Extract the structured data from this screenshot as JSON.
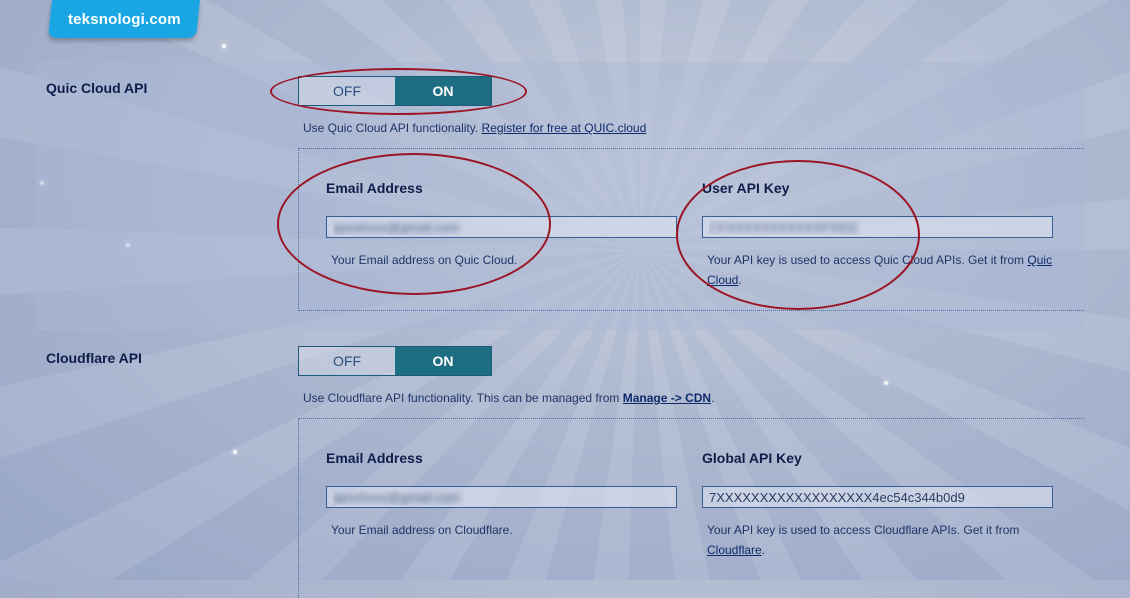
{
  "brand": {
    "logo_text": "teksnologi.com"
  },
  "quic": {
    "label": "Quic Cloud API",
    "toggle": {
      "off_label": "OFF",
      "on_label": "ON",
      "selected": "ON"
    },
    "description": "Use Quic Cloud API functionality.",
    "description_link": "Register for free at QUIC.cloud",
    "email_label": "Email Address",
    "email_value": "apxxhxxx@gmail.com",
    "email_help": "Your Email address on Quic Cloud.",
    "key_label": "User API Key",
    "key_value": "CFXXXXXXXXXXXFXEQ",
    "key_help": "Your API key is used to access Quic Cloud APIs. Get it from",
    "key_help_link": "Quic Cloud",
    "key_help_end": "."
  },
  "cloudflare": {
    "label": "Cloudflare API",
    "toggle": {
      "off_label": "OFF",
      "on_label": "ON",
      "selected": "ON"
    },
    "description": "Use Cloudflare API functionality. This can be managed from",
    "description_link": "Manage -> CDN",
    "description_end": ".",
    "email_label": "Email Address",
    "email_value": "apxxhxxx@gmail.com",
    "email_help": "Your Email address on Cloudflare.",
    "key_label": "Global API Key",
    "key_value": "7XXXXXXXXXXXXXXXXXX4ec54c344b0d9",
    "key_help": "Your API key is used to access Cloudflare APIs. Get it from",
    "key_help_link": "Cloudflare",
    "key_help_end": "."
  },
  "colors": {
    "accent": "#1e6e83",
    "annotation": "#9b1424",
    "logo_bg": "#1aa6e3"
  }
}
